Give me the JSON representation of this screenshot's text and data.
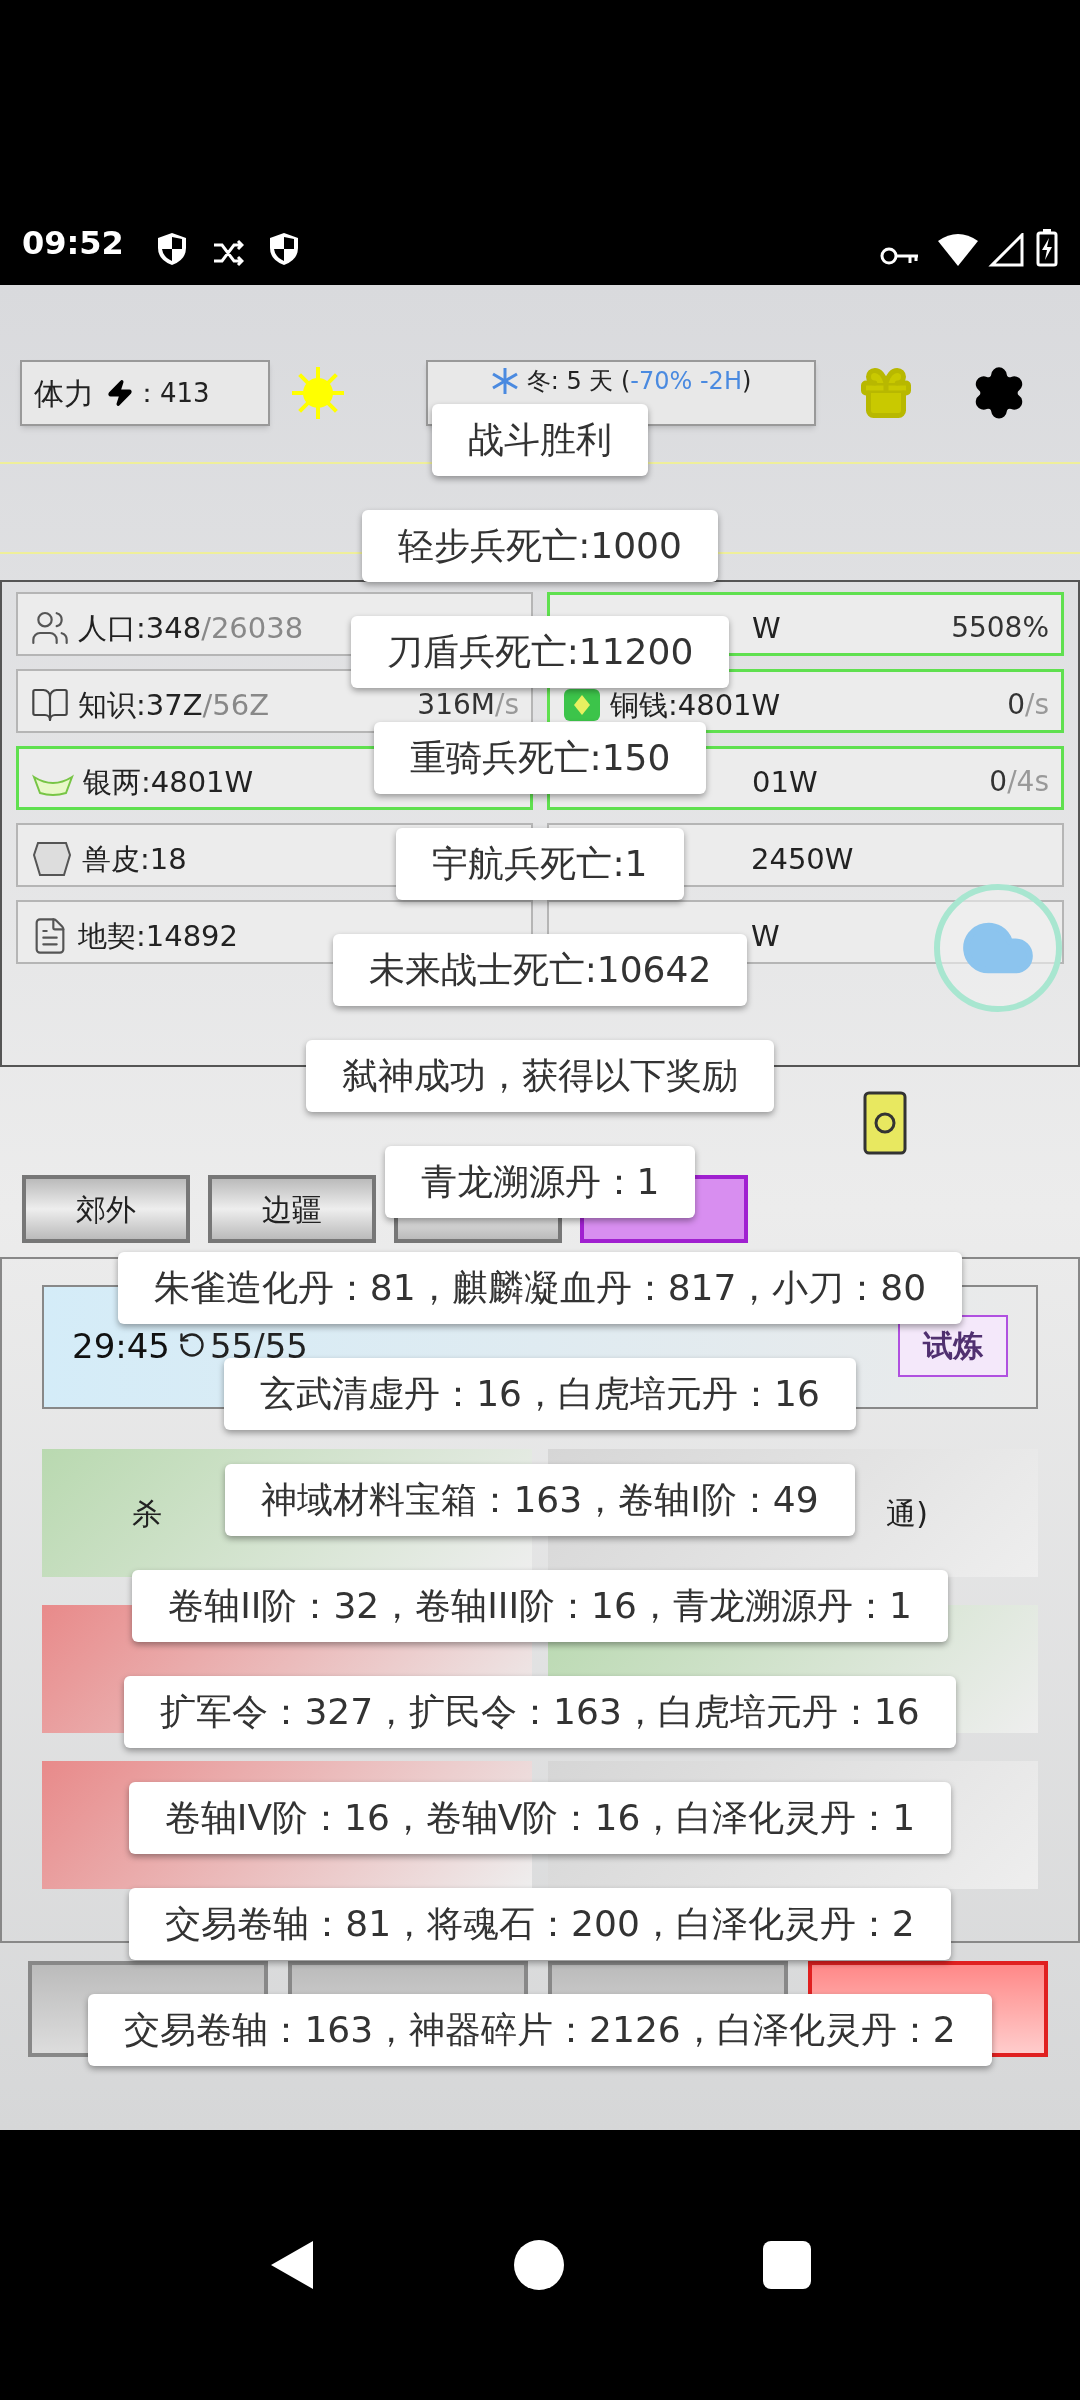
{
  "status_bar": {
    "time": "09:52"
  },
  "header": {
    "stamina_label": "体力",
    "stamina_value": "：413",
    "season": "冬: 5 天 (",
    "season_effect": "-70% -2H",
    "season_end": ")"
  },
  "resources_left": [
    {
      "label": "人口:348",
      "max": "/26038",
      "highlight": false
    },
    {
      "label": "知识:37Z",
      "max": "/56Z",
      "rate": "316M",
      "rate_unit": "/s",
      "highlight": false
    },
    {
      "label": "银两:4801W",
      "highlight": true
    },
    {
      "label": "兽皮:18",
      "highlight": false
    },
    {
      "label": "地契:14892",
      "highlight": false
    }
  ],
  "resources_right": [
    {
      "kind": "plain",
      "label": "W",
      "value": "5508%",
      "highlight": true
    },
    {
      "kind": "icon",
      "label": "铜钱:4801W",
      "value": "0",
      "unit": "/s",
      "highlight": true
    },
    {
      "kind": "plain",
      "label": "01W",
      "value": "0",
      "unit": "/4s",
      "highlight": true
    },
    {
      "kind": "plain",
      "label": "2450W",
      "highlight": false
    },
    {
      "kind": "plain",
      "label": "W",
      "highlight": false
    }
  ],
  "tabs": [
    {
      "label": "郊外",
      "selected": false
    },
    {
      "label": "边疆",
      "selected": false
    },
    {
      "selected": false
    },
    {
      "selected": true
    }
  ],
  "boss": {
    "timer": "29:45",
    "attempts": "55/55",
    "trial_button": "试炼"
  },
  "cards": [
    {
      "color": "#b9d9b0",
      "text": "杀"
    },
    {
      "color": "#d6d6d6",
      "text": "通)"
    },
    {
      "color": "#e88a8a"
    },
    {
      "color": "#b9d9b0"
    },
    {
      "color": "#e88a8a"
    },
    {
      "color": "#d6d6d6"
    }
  ],
  "bottom_buttons": [
    {
      "selected": false
    },
    {
      "selected": false
    },
    {
      "selected": false
    },
    {
      "selected": true
    }
  ],
  "toasts": [
    "战斗胜利",
    "轻步兵死亡:1000",
    "刀盾兵死亡:11200",
    "重骑兵死亡:150",
    "宇航兵死亡:1",
    "未来战士死亡:10642",
    "弑神成功，获得以下奖励",
    "青龙溯源丹：1",
    "朱雀造化丹：81，麒麟凝血丹：817，小刀：80",
    "玄武清虚丹：16，白虎培元丹：16",
    "神域材料宝箱：163，卷轴I阶：49",
    "卷轴II阶：32，卷轴III阶：16，青龙溯源丹：1",
    "扩军令：327，扩民令：163，白虎培元丹：16",
    "卷轴IV阶：16，卷轴V阶：16，白泽化灵丹：1",
    "交易卷轴：81，将魂石：200，白泽化灵丹：2",
    "交易卷轴：163，神器碎片：2126，白泽化灵丹：2"
  ]
}
